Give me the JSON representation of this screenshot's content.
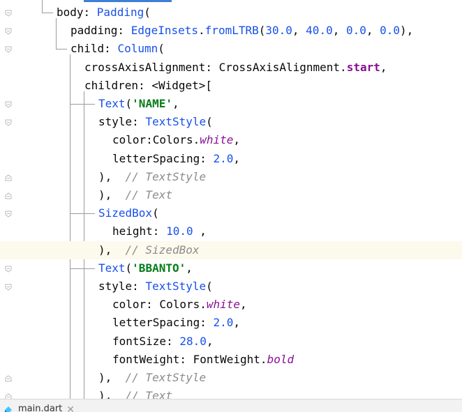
{
  "editor": {
    "lines": [
      {
        "segments": [
          {
            "t": "body: ",
            "c": "k"
          },
          {
            "t": "Padding",
            "c": "cls"
          },
          {
            "t": "(",
            "c": "k"
          }
        ]
      },
      {
        "segments": [
          {
            "t": "padding: ",
            "c": "k"
          },
          {
            "t": "EdgeInsets",
            "c": "cls"
          },
          {
            "t": ".",
            "c": "k"
          },
          {
            "t": "fromLTRB",
            "c": "cls"
          },
          {
            "t": "(",
            "c": "k"
          },
          {
            "t": "30.0",
            "c": "num"
          },
          {
            "t": ", ",
            "c": "k"
          },
          {
            "t": "40.0",
            "c": "num"
          },
          {
            "t": ", ",
            "c": "k"
          },
          {
            "t": "0.0",
            "c": "num"
          },
          {
            "t": ", ",
            "c": "k"
          },
          {
            "t": "0.0",
            "c": "num"
          },
          {
            "t": "),",
            "c": "k"
          }
        ]
      },
      {
        "segments": [
          {
            "t": "child: ",
            "c": "k"
          },
          {
            "t": "Column",
            "c": "cls"
          },
          {
            "t": "(",
            "c": "k"
          }
        ]
      },
      {
        "segments": [
          {
            "t": "crossAxisAlignment: ",
            "c": "k"
          },
          {
            "t": "CrossAxisAlignment.",
            "c": "k"
          },
          {
            "t": "start",
            "c": "propb"
          },
          {
            "t": ",",
            "c": "k"
          }
        ]
      },
      {
        "segments": [
          {
            "t": "children: <Widget>[",
            "c": "k"
          }
        ]
      },
      {
        "segments": [
          {
            "t": "Text",
            "c": "cls"
          },
          {
            "t": "(",
            "c": "k"
          },
          {
            "t": "'NAME'",
            "c": "str"
          },
          {
            "t": ",",
            "c": "k"
          }
        ]
      },
      {
        "segments": [
          {
            "t": "style: ",
            "c": "k"
          },
          {
            "t": "TextStyle",
            "c": "cls"
          },
          {
            "t": "(",
            "c": "k"
          }
        ]
      },
      {
        "segments": [
          {
            "t": "color:Colors.",
            "c": "k"
          },
          {
            "t": "white",
            "c": "prop"
          },
          {
            "t": ",",
            "c": "k"
          }
        ]
      },
      {
        "segments": [
          {
            "t": "letterSpacing: ",
            "c": "k"
          },
          {
            "t": "2.0",
            "c": "num"
          },
          {
            "t": ",",
            "c": "k"
          }
        ]
      },
      {
        "segments": [
          {
            "t": "),  ",
            "c": "k"
          },
          {
            "t": "// TextStyle",
            "c": "cmt"
          }
        ]
      },
      {
        "segments": [
          {
            "t": "),  ",
            "c": "k"
          },
          {
            "t": "// Text",
            "c": "cmt"
          }
        ]
      },
      {
        "segments": [
          {
            "t": "SizedBox",
            "c": "cls"
          },
          {
            "t": "(",
            "c": "k"
          }
        ]
      },
      {
        "segments": [
          {
            "t": "height: ",
            "c": "k"
          },
          {
            "t": "10.0",
            "c": "num"
          },
          {
            "t": " ,",
            "c": "k"
          }
        ]
      },
      {
        "segments": [
          {
            "t": "),  ",
            "c": "k"
          },
          {
            "t": "// SizedBox",
            "c": "cmt"
          }
        ]
      },
      {
        "segments": [
          {
            "t": "Text",
            "c": "cls"
          },
          {
            "t": "(",
            "c": "k"
          },
          {
            "t": "'BBANTO'",
            "c": "str"
          },
          {
            "t": ",",
            "c": "k"
          }
        ]
      },
      {
        "segments": [
          {
            "t": "style: ",
            "c": "k"
          },
          {
            "t": "TextStyle",
            "c": "cls"
          },
          {
            "t": "(",
            "c": "k"
          }
        ]
      },
      {
        "segments": [
          {
            "t": "color: Colors.",
            "c": "k"
          },
          {
            "t": "white",
            "c": "prop"
          },
          {
            "t": ",",
            "c": "k"
          }
        ]
      },
      {
        "segments": [
          {
            "t": "letterSpacing: ",
            "c": "k"
          },
          {
            "t": "2.0",
            "c": "num"
          },
          {
            "t": ",",
            "c": "k"
          }
        ]
      },
      {
        "segments": [
          {
            "t": "fontSize: ",
            "c": "k"
          },
          {
            "t": "28.0",
            "c": "num"
          },
          {
            "t": ",",
            "c": "k"
          }
        ]
      },
      {
        "segments": [
          {
            "t": "fontWeight: FontWeight.",
            "c": "k"
          },
          {
            "t": "bold",
            "c": "prop"
          }
        ]
      },
      {
        "segments": [
          {
            "t": "),  ",
            "c": "k"
          },
          {
            "t": "// TextStyle",
            "c": "cmt"
          }
        ]
      },
      {
        "segments": [
          {
            "t": "),  ",
            "c": "k"
          },
          {
            "t": "// Text",
            "c": "cmt"
          }
        ]
      }
    ],
    "current_line_index": 13
  },
  "tabbar": {
    "file_name": "main.dart"
  },
  "icons": {
    "fold_open": "fold-open-icon",
    "fold_close": "fold-close-icon",
    "dart_file": "dart-file-icon",
    "close": "close-icon"
  }
}
